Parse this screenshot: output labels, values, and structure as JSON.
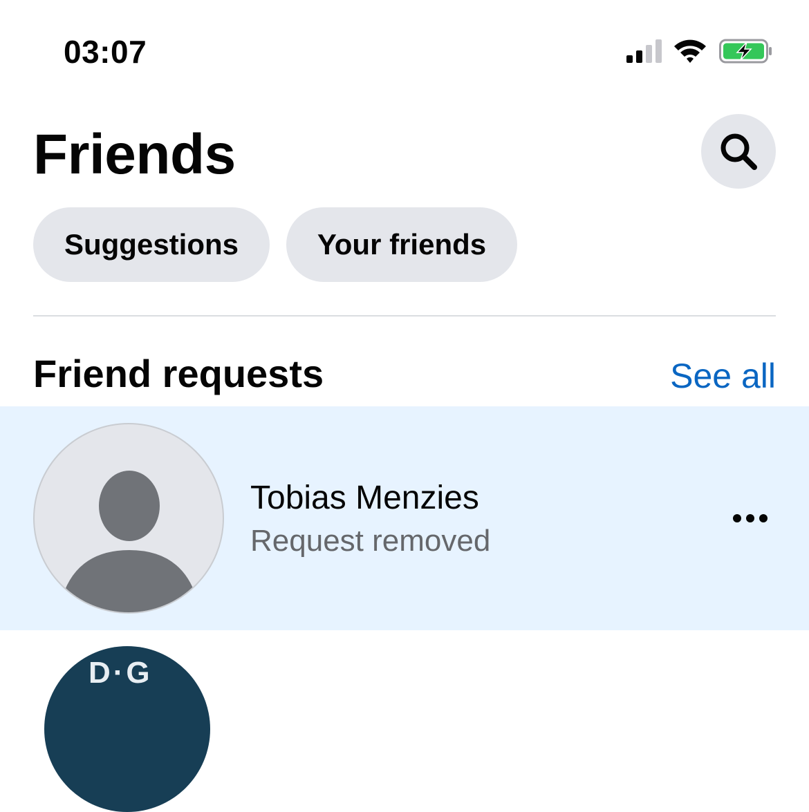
{
  "status_bar": {
    "time": "03:07",
    "icons": [
      "cellular-signal-icon",
      "wifi-icon",
      "battery-charging-icon"
    ],
    "battery_color": "#34c759"
  },
  "header": {
    "title": "Friends",
    "search_icon": "search-icon"
  },
  "chips": [
    {
      "label": "Suggestions"
    },
    {
      "label": "Your friends"
    }
  ],
  "friend_requests": {
    "title": "Friend requests",
    "see_all_label": "See all",
    "items": [
      {
        "name": "Tobias Menzies",
        "status": "Request removed",
        "avatar": "default-avatar-icon",
        "more_icon": "more-horizontal-icon"
      }
    ]
  },
  "colors": {
    "accent": "#0a66c2",
    "chip_bg": "#e4e6eb",
    "highlight_row": "#e7f3ff",
    "secondary_text": "#65676b"
  }
}
